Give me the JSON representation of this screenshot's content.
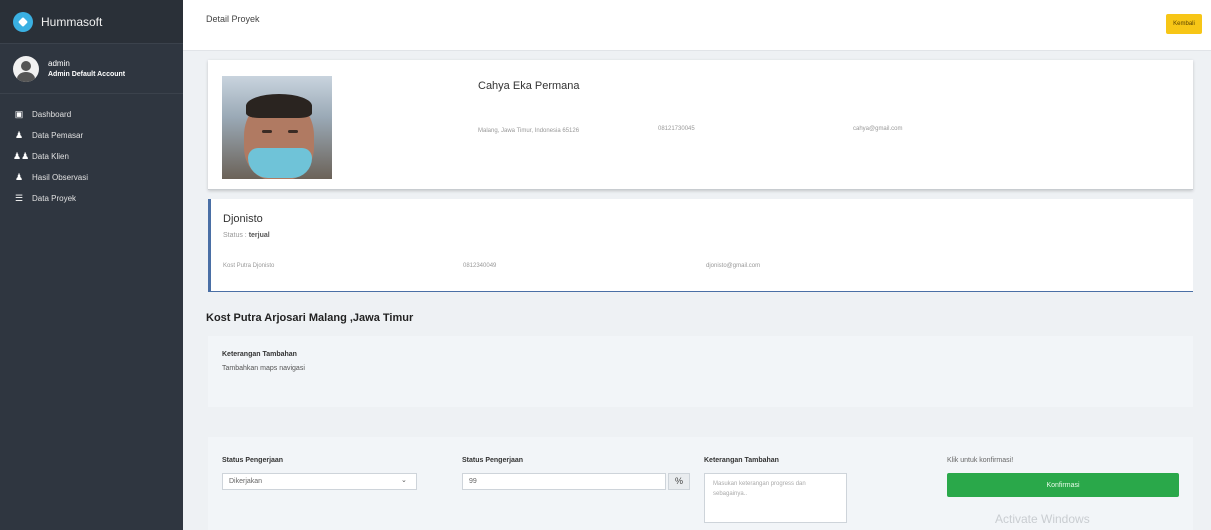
{
  "brand": {
    "name": "Hummasoft"
  },
  "user": {
    "name": "admin",
    "role": "Admin Default Account"
  },
  "nav": [
    {
      "label": "Dashboard",
      "icon": "dashboard-icon"
    },
    {
      "label": "Data Pemasar",
      "icon": "user-icon"
    },
    {
      "label": "Data Klien",
      "icon": "users-icon"
    },
    {
      "label": "Hasil Observasi",
      "icon": "user-icon"
    },
    {
      "label": "Data Proyek",
      "icon": "list-icon"
    }
  ],
  "header": {
    "title": "Detail Proyek",
    "back_label": "Kembali"
  },
  "worker": {
    "name": "Cahya Eka Permana",
    "address": "Malang, Jawa Timur, Indonesia 65126",
    "phone": "08121730045",
    "email": "cahya@gmail.com"
  },
  "client": {
    "name": "Djonisto",
    "status_label": "Status :",
    "status_value": "terjual",
    "kost": "Kost Putra Djonisto",
    "phone": "0812340049",
    "email": "djonisto@gmail.com"
  },
  "project": {
    "title": "Kost Putra Arjosari Malang ,Jawa Timur",
    "note_label": "Keterangan Tambahan",
    "note_text": "Tambahkan maps navigasi"
  },
  "form": {
    "status_label": "Status Pengerjaan",
    "status_value": "Dikerjakan",
    "percent_label": "Status Pengerjaan",
    "percent_value": "99",
    "percent_symbol": "%",
    "notes_label": "Keterangan Tambahan",
    "notes_placeholder": "Masukan keterangan progress dan sebagainya..",
    "confirm_hint": "Klik untuk konfirmasi!",
    "confirm_label": "Konfirmasi"
  },
  "watermark": "Activate Windows"
}
